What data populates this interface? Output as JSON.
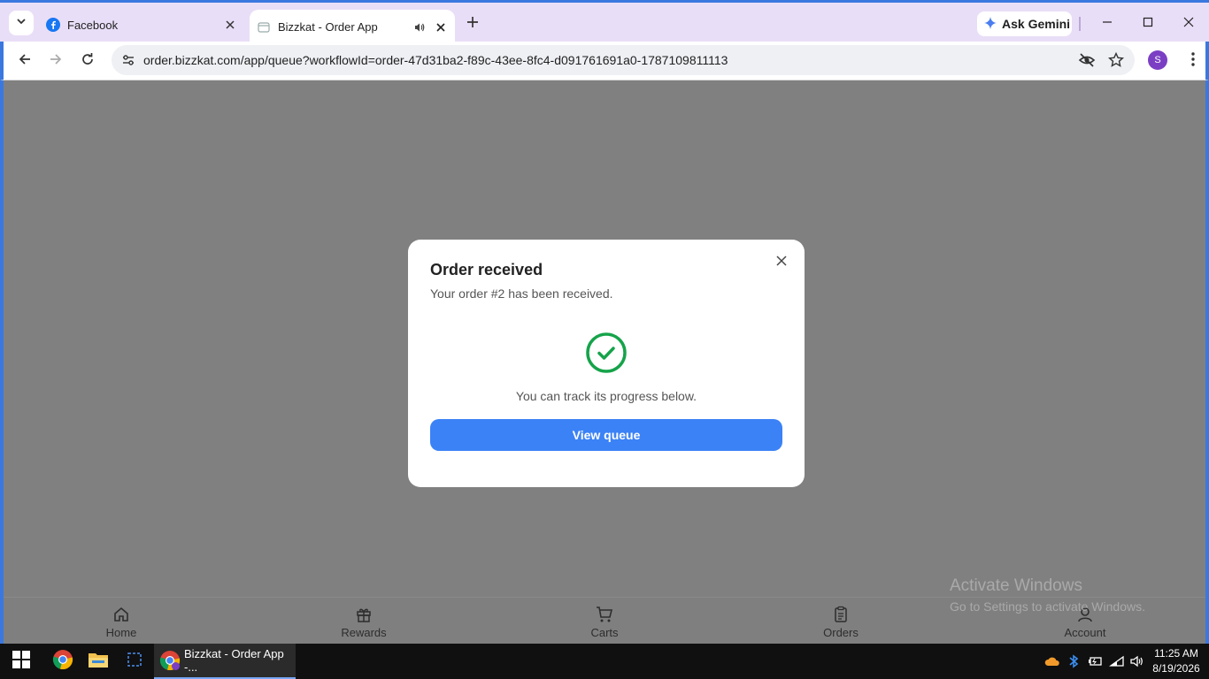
{
  "browser": {
    "tabs": [
      {
        "title": "Facebook",
        "icon": "facebook-icon",
        "active": false
      },
      {
        "title": "Bizzkat - Order App",
        "icon": "page-icon",
        "active": true
      }
    ],
    "ask_gemini_label": "Ask Gemini",
    "url": "order.bizzkat.com/app/queue?workflowId=order-47d31ba2-f89c-43ee-8fc4-d091761691a0-1787109811113",
    "profile_initial": "S"
  },
  "modal": {
    "title": "Order received",
    "subtitle": "Your order #2 has been received.",
    "track_text": "You can track its progress below.",
    "button_label": "View queue",
    "accent_color": "#3b82f6",
    "success_color": "#16a34a"
  },
  "bottom_nav": {
    "items": [
      {
        "label": "Home",
        "icon": "home-icon"
      },
      {
        "label": "Rewards",
        "icon": "gift-icon"
      },
      {
        "label": "Carts",
        "icon": "cart-icon"
      },
      {
        "label": "Orders",
        "icon": "clipboard-icon"
      },
      {
        "label": "Account",
        "icon": "user-icon"
      }
    ]
  },
  "watermark": {
    "line1": "Activate Windows",
    "line2": "Go to Settings to activate Windows."
  },
  "taskbar": {
    "active_task_label": "Bizzkat - Order App -...",
    "time": "11:25 AM",
    "date": "8/19/2026"
  }
}
